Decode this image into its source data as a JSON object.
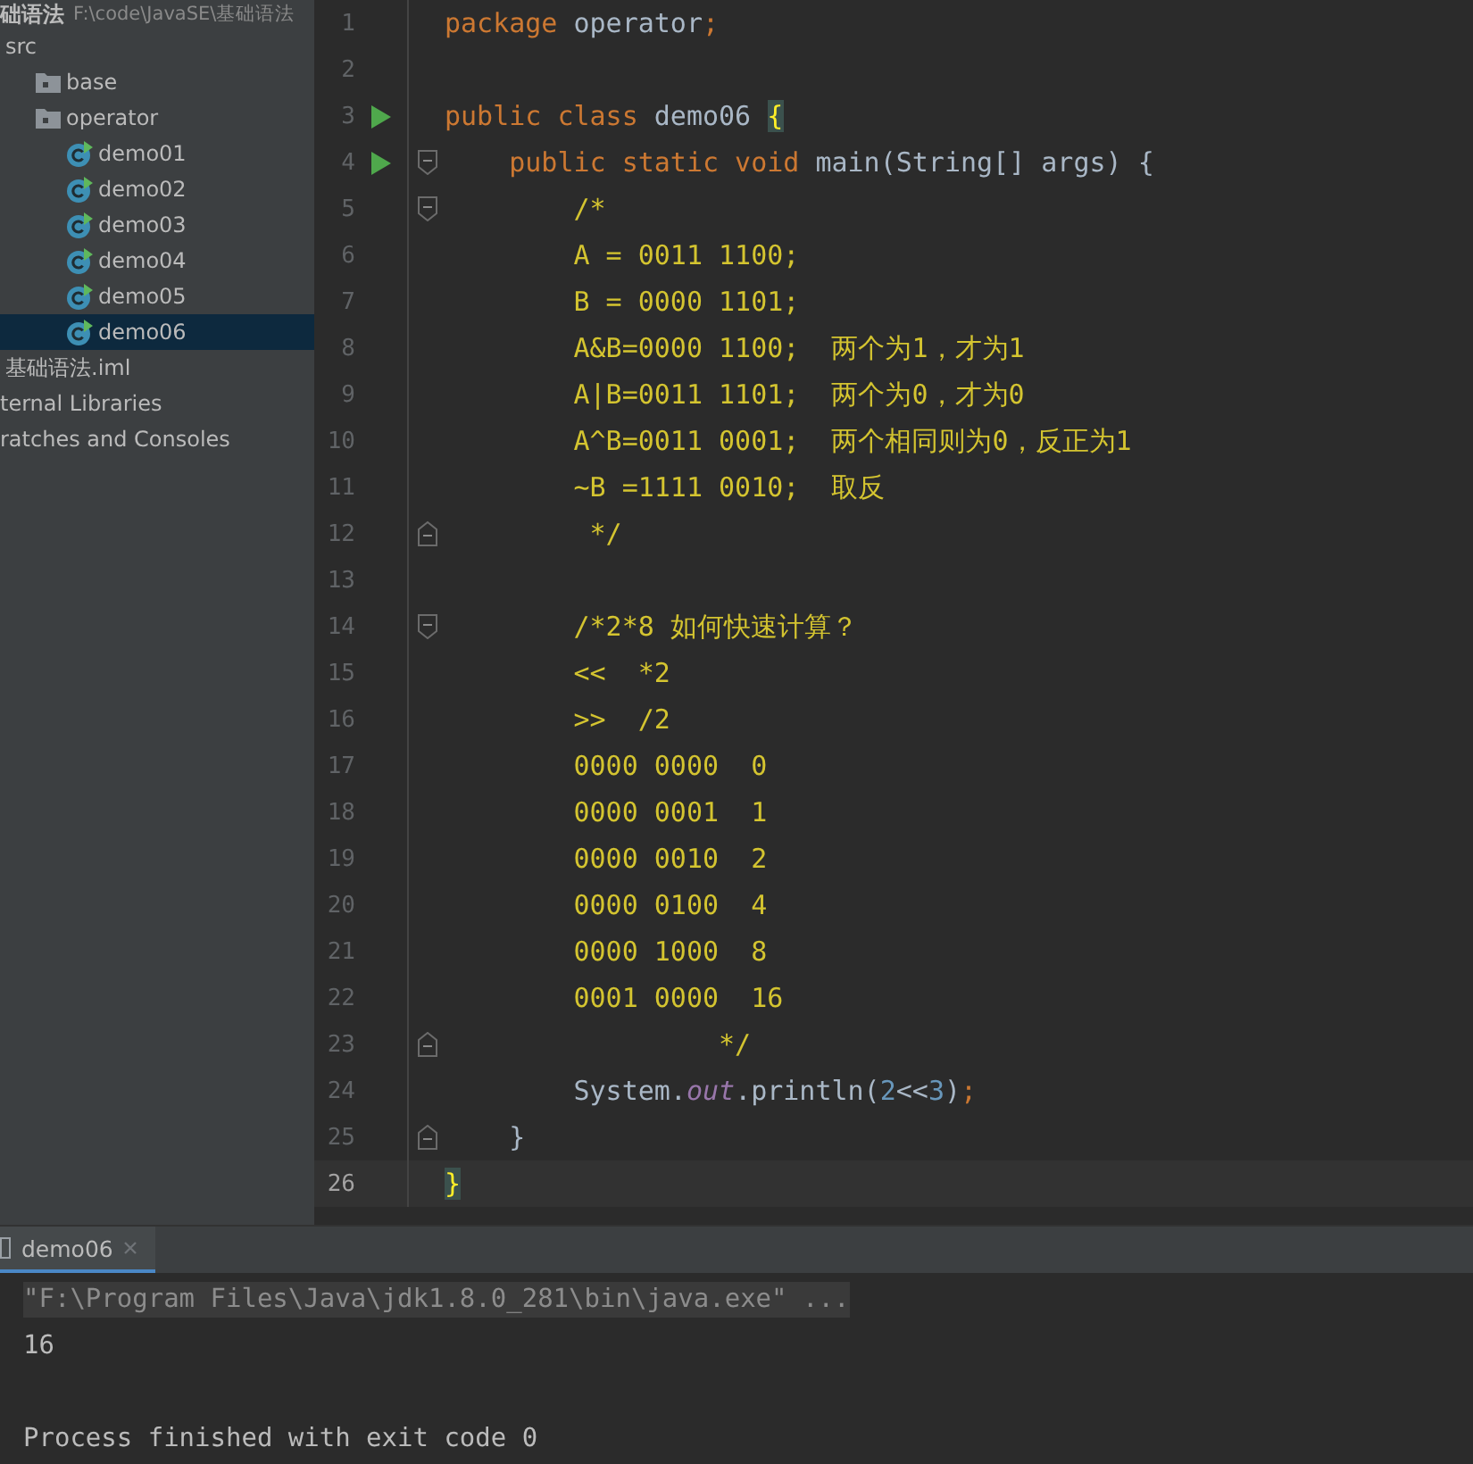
{
  "project_tree": [
    {
      "label": "础语法",
      "path": "F:\\code\\JavaSE\\基础语法",
      "selected": false,
      "children": [
        {
          "label": "src",
          "selected": false,
          "children": [
            {
              "label": "base",
              "kind": "folder",
              "selected": false
            },
            {
              "label": "operator",
              "kind": "folder",
              "selected": false,
              "children": [
                {
                  "label": "demo01",
                  "kind": "class",
                  "selected": false
                },
                {
                  "label": "demo02",
                  "kind": "class",
                  "selected": false
                },
                {
                  "label": "demo03",
                  "kind": "class",
                  "selected": false
                },
                {
                  "label": "demo04",
                  "kind": "class",
                  "selected": false
                },
                {
                  "label": "demo05",
                  "kind": "class",
                  "selected": false
                },
                {
                  "label": "demo06",
                  "kind": "class",
                  "selected": true
                }
              ]
            }
          ]
        },
        {
          "label": "基础语法.iml",
          "selected": false
        }
      ]
    },
    {
      "label": "ternal Libraries",
      "selected": false
    },
    {
      "label": "ratches and Consoles",
      "selected": false
    }
  ],
  "editor": {
    "lines": [
      {
        "number": "1",
        "tokens": [
          {
            "kind": "keyword",
            "text": "package "
          },
          {
            "kind": "plain",
            "text": "operator"
          },
          {
            "kind": "keyword",
            "text": ";"
          }
        ]
      },
      {
        "number": "2"
      },
      {
        "number": "3",
        "run": true,
        "tokens": [
          {
            "kind": "keyword",
            "text": "public class "
          },
          {
            "kind": "plain",
            "text": "demo06 "
          },
          {
            "kind": "match",
            "text": "{"
          }
        ]
      },
      {
        "number": "4",
        "run": true,
        "fold_start": true,
        "tokens": [
          {
            "kind": "keyword",
            "text": "    public static void "
          },
          {
            "kind": "plain",
            "text": "main(String[] args) {"
          }
        ]
      },
      {
        "number": "5",
        "fold_start": true,
        "tokens": [
          {
            "kind": "comment",
            "text": "        /*"
          }
        ]
      },
      {
        "number": "6",
        "tokens": [
          {
            "kind": "comment",
            "text": "        A = 0011 1100;"
          }
        ]
      },
      {
        "number": "7",
        "tokens": [
          {
            "kind": "comment",
            "text": "        B = 0000 1101;"
          }
        ]
      },
      {
        "number": "8",
        "tokens": [
          {
            "kind": "comment",
            "text": "        A&B=0000 1100;  两个为1，才为1"
          }
        ]
      },
      {
        "number": "9",
        "tokens": [
          {
            "kind": "comment",
            "text": "        A|B=0011 1101;  两个为0，才为0"
          }
        ]
      },
      {
        "number": "10",
        "tokens": [
          {
            "kind": "comment",
            "text": "        A^B=0011 0001;  两个相同则为0，反正为1"
          }
        ]
      },
      {
        "number": "11",
        "tokens": [
          {
            "kind": "comment",
            "text": "        ~B =1111 0010;  取反"
          }
        ]
      },
      {
        "number": "12",
        "fold_end": true,
        "tokens": [
          {
            "kind": "comment",
            "text": "         */"
          }
        ]
      },
      {
        "number": "13"
      },
      {
        "number": "14",
        "fold_start": true,
        "tokens": [
          {
            "kind": "comment",
            "text": "        /*2*8 如何快速计算？"
          }
        ]
      },
      {
        "number": "15",
        "tokens": [
          {
            "kind": "comment",
            "text": "        <<  *2"
          }
        ]
      },
      {
        "number": "16",
        "tokens": [
          {
            "kind": "comment",
            "text": "        >>  /2"
          }
        ]
      },
      {
        "number": "17",
        "tokens": [
          {
            "kind": "comment",
            "text": "        0000 0000  0"
          }
        ]
      },
      {
        "number": "18",
        "tokens": [
          {
            "kind": "comment",
            "text": "        0000 0001  1"
          }
        ]
      },
      {
        "number": "19",
        "tokens": [
          {
            "kind": "comment",
            "text": "        0000 0010  2"
          }
        ]
      },
      {
        "number": "20",
        "tokens": [
          {
            "kind": "comment",
            "text": "        0000 0100  4"
          }
        ]
      },
      {
        "number": "21",
        "tokens": [
          {
            "kind": "comment",
            "text": "        0000 1000  8"
          }
        ]
      },
      {
        "number": "22",
        "tokens": [
          {
            "kind": "comment",
            "text": "        0001 0000  16"
          }
        ]
      },
      {
        "number": "23",
        "fold_end": true,
        "tokens": [
          {
            "kind": "comment",
            "text": "                 */"
          }
        ]
      },
      {
        "number": "24",
        "tokens": [
          {
            "kind": "plain",
            "text": "        System."
          },
          {
            "kind": "field",
            "text": "out"
          },
          {
            "kind": "plain",
            "text": ".println("
          },
          {
            "kind": "number",
            "text": "2"
          },
          {
            "kind": "plain",
            "text": "<<"
          },
          {
            "kind": "number",
            "text": "3"
          },
          {
            "kind": "plain",
            "text": ")"
          },
          {
            "kind": "keyword",
            "text": ";"
          }
        ]
      },
      {
        "number": "25",
        "fold_end": true,
        "tokens": [
          {
            "kind": "plain",
            "text": "    }"
          }
        ]
      },
      {
        "number": "26",
        "current": true,
        "tokens": [
          {
            "kind": "match",
            "text": "}"
          }
        ]
      }
    ]
  },
  "run_panel": {
    "tabs": [
      {
        "label": "demo06",
        "selected": true
      }
    ],
    "console": [
      {
        "kind": "command",
        "text": "\"F:\\Program Files\\Java\\jdk1.8.0_281\\bin\\java.exe\" ..."
      },
      {
        "kind": "output",
        "text": "16"
      },
      {
        "kind": "exit",
        "text": "Process finished with exit code 0"
      }
    ]
  }
}
